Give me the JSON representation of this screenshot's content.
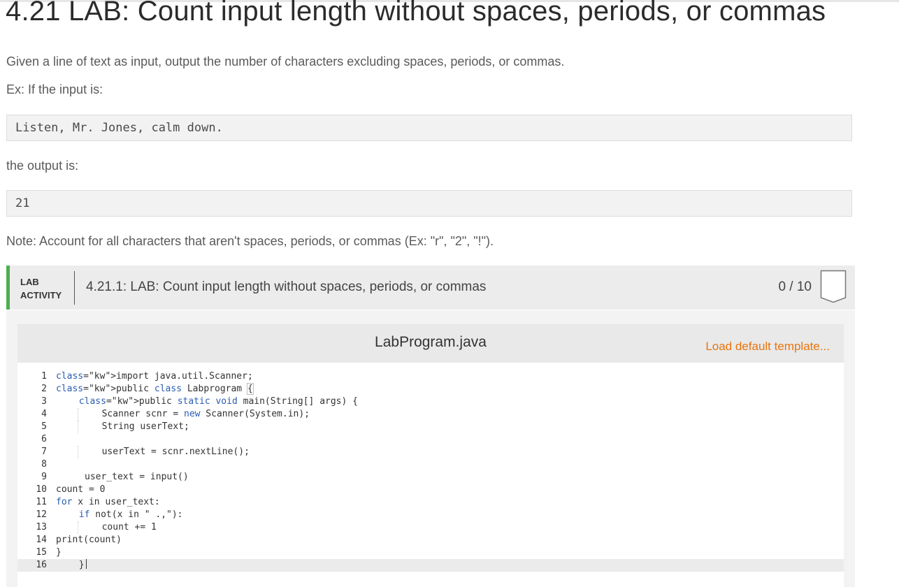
{
  "page": {
    "title": "4.21 LAB: Count input length without spaces, periods, or commas",
    "description": "Given a line of text as input, output the number of characters excluding spaces, periods, or commas.",
    "example_intro": "Ex: If the input is:",
    "example_input": "Listen, Mr. Jones, calm down.",
    "output_intro": "the output is:",
    "example_output": "21",
    "note": "Note: Account for all characters that aren't spaces, periods, or commas (Ex: \"r\", \"2\", \"!\")."
  },
  "lab": {
    "badge_line1": "LAB",
    "badge_line2": "ACTIVITY",
    "title": "4.21.1: LAB: Count input length without spaces, periods, or commas",
    "score": "0 / 10",
    "accent_color": "#4caf50",
    "status_icon": "shield-icon"
  },
  "editor": {
    "filename": "LabProgram.java",
    "load_template": "Load default template...",
    "link_color": "#e8750d",
    "lines": [
      {
        "n": "1",
        "text": "import java.util.Scanner;"
      },
      {
        "n": "2",
        "text": "public class Labprogram {"
      },
      {
        "n": "3",
        "text": "public static void main(String[] args) {"
      },
      {
        "n": "4",
        "text": "Scanner scnr = new Scanner(System.in);"
      },
      {
        "n": "5",
        "text": "String userText;"
      },
      {
        "n": "6",
        "text": ""
      },
      {
        "n": "7",
        "text": "userText = scnr.nextLine();"
      },
      {
        "n": "8",
        "text": ""
      },
      {
        "n": "9",
        "text": "user_text = input()"
      },
      {
        "n": "10",
        "text": "count = 0"
      },
      {
        "n": "11",
        "text": "for x in user_text:"
      },
      {
        "n": "12",
        "text": "if not(x in \" .,\"):"
      },
      {
        "n": "13",
        "text": "count += 1"
      },
      {
        "n": "14",
        "text": "print(count)"
      },
      {
        "n": "15",
        "text": "}"
      },
      {
        "n": "16",
        "text": "}"
      }
    ]
  }
}
